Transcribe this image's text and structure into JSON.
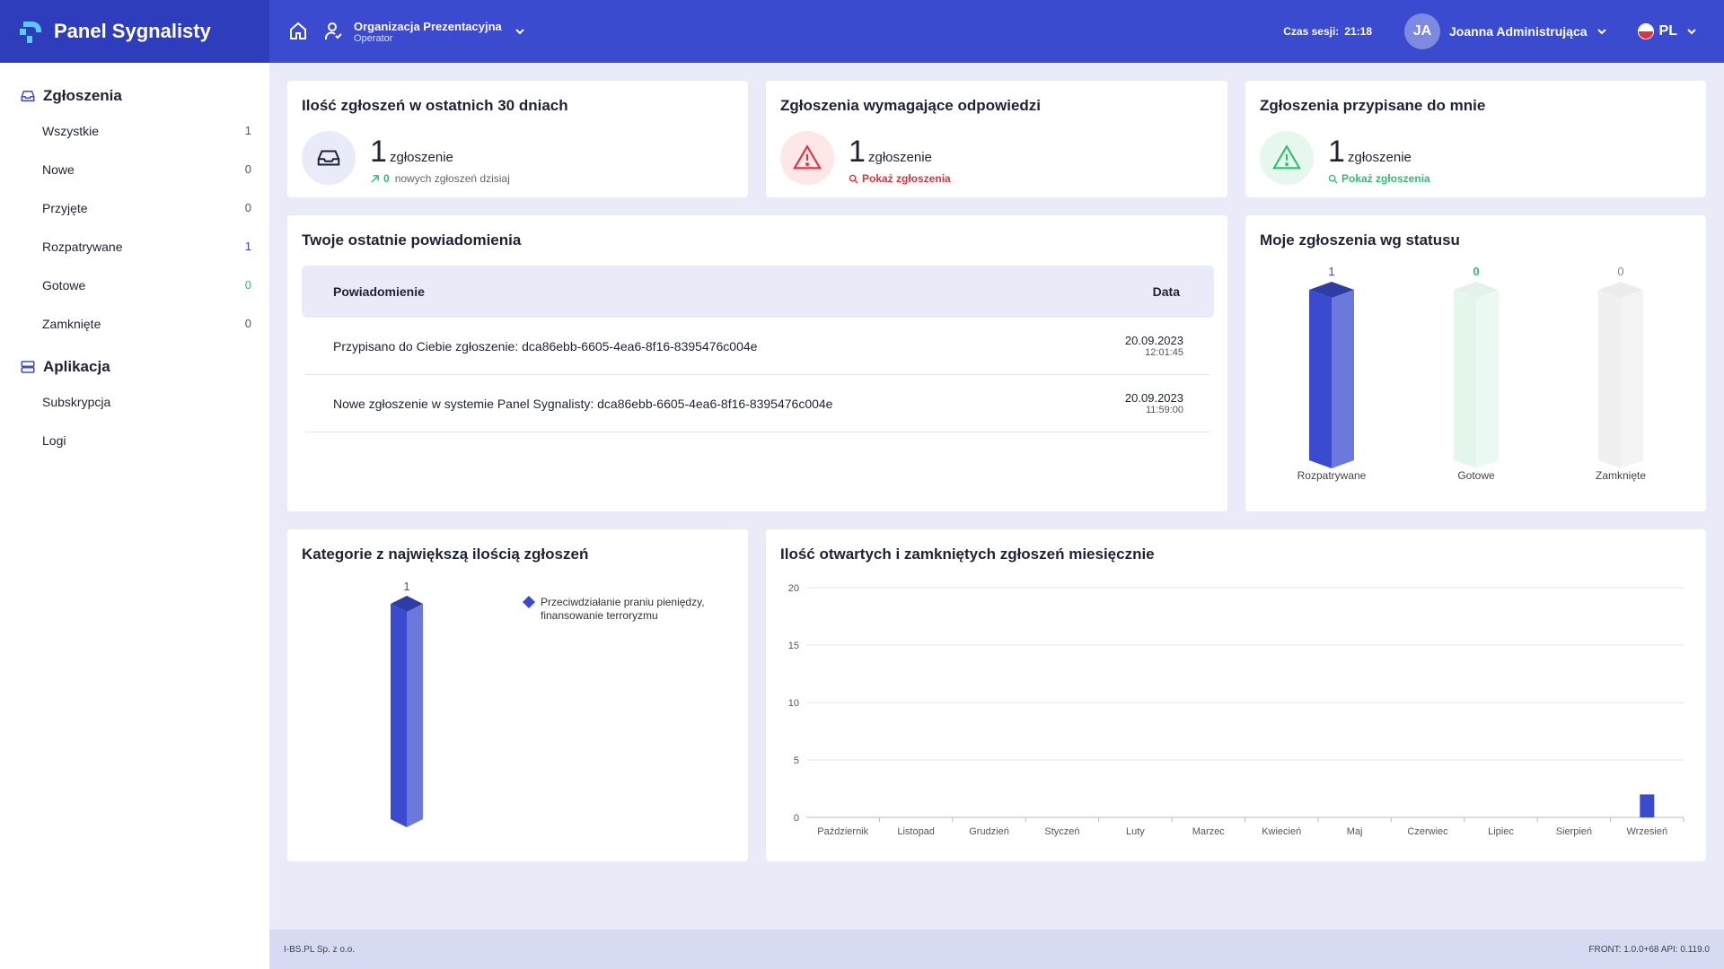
{
  "brand": {
    "name": "Panel Sygnalisty"
  },
  "header": {
    "org_name": "Organizacja Prezentacyjna",
    "org_role": "Operator",
    "session_label": "Czas sesji:",
    "session_time": "21:18",
    "user_initials": "JA",
    "user_name": "Joanna Administrująca",
    "language": "PL"
  },
  "sidebar": {
    "section1": "Zgłoszenia",
    "items": [
      {
        "label": "Wszystkie",
        "count": "1"
      },
      {
        "label": "Nowe",
        "count": "0"
      },
      {
        "label": "Przyjęte",
        "count": "0"
      },
      {
        "label": "Rozpatrywane",
        "count": "1"
      },
      {
        "label": "Gotowe",
        "count": "0"
      },
      {
        "label": "Zamknięte",
        "count": "0"
      }
    ],
    "section2": "Aplikacja",
    "app_items": [
      {
        "label": "Subskrypcja"
      },
      {
        "label": "Logi"
      }
    ]
  },
  "stats": {
    "last30": {
      "title": "Ilość zgłoszeń w ostatnich 30 dniach",
      "num": "1",
      "unit": "zgłoszenie",
      "today_num": "0",
      "today_text": "nowych zgłoszeń dzisiaj"
    },
    "needs_reply": {
      "title": "Zgłoszenia wymagające odpowiedzi",
      "num": "1",
      "unit": "zgłoszenie",
      "link": "Pokaż zgłoszenia"
    },
    "assigned": {
      "title": "Zgłoszenia przypisane do mnie",
      "num": "1",
      "unit": "zgłoszenie",
      "link": "Pokaż zgłoszenia"
    }
  },
  "notifications": {
    "title": "Twoje ostatnie powiadomienia",
    "col_notification": "Powiadomienie",
    "col_date": "Data",
    "rows": [
      {
        "text": "Przypisano do Ciebie zgłoszenie: dca86ebb-6605-4ea6-8f16-8395476c004e",
        "date": "20.09.2023",
        "time": "12:01:45"
      },
      {
        "text": "Nowe zgłoszenie w systemie Panel Sygnalisty: dca86ebb-6605-4ea6-8f16-8395476c004e",
        "date": "20.09.2023",
        "time": "11:59:00"
      }
    ]
  },
  "status_chart": {
    "title": "Moje zgłoszenia wg statusu"
  },
  "category_chart": {
    "title": "Kategorie z największą ilością zgłoszeń"
  },
  "monthly_chart": {
    "title": "Ilość otwartych i zamkniętych zgłoszeń miesięcznie"
  },
  "chart_data": [
    {
      "type": "bar",
      "title": "Moje zgłoszenia wg statusu",
      "categories": [
        "Rozpatrywane",
        "Gotowe",
        "Zamknięte"
      ],
      "values": [
        1,
        0,
        0
      ],
      "colors": [
        "#3a4bd0",
        "#2fbf71",
        "#8a8a8a"
      ]
    },
    {
      "type": "bar",
      "title": "Kategorie z największą ilością zgłoszeń",
      "categories": [
        "Przeciwdziałanie praniu pieniędzy, finansowanie terroryzmu"
      ],
      "values": [
        1
      ],
      "legend": "right"
    },
    {
      "type": "bar",
      "title": "Ilość otwartych i zamkniętych zgłoszeń miesięcznie",
      "categories": [
        "Październik",
        "Listopad",
        "Grudzień",
        "Styczeń",
        "Luty",
        "Marzec",
        "Kwiecień",
        "Maj",
        "Czerwiec",
        "Lipiec",
        "Sierpień",
        "Wrzesień"
      ],
      "values": [
        0,
        0,
        0,
        0,
        0,
        0,
        0,
        0,
        0,
        0,
        0,
        2
      ],
      "yticks": [
        "0",
        "5",
        "10",
        "15",
        "20"
      ],
      "ylim": [
        0,
        20
      ]
    }
  ],
  "footer": {
    "company": "I-BS.PL Sp. z o.o.",
    "version": "FRONT: 1.0.0+68  API: 0.119.0"
  }
}
